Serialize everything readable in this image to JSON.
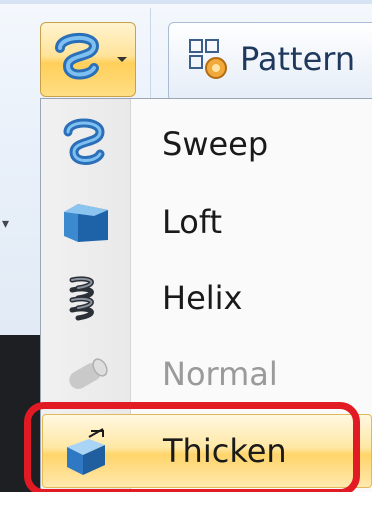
{
  "ribbon": {
    "sweep_button_icon": "sweep-icon",
    "pattern_button": {
      "label": "Pattern",
      "icon": "pattern-icon"
    }
  },
  "menu": {
    "items": [
      {
        "label": "Sweep",
        "icon": "sweep-icon",
        "enabled": true
      },
      {
        "label": "Loft",
        "icon": "loft-icon",
        "enabled": true
      },
      {
        "label": "Helix",
        "icon": "helix-icon",
        "enabled": true
      },
      {
        "label": "Normal",
        "icon": "normal-icon",
        "enabled": false
      },
      {
        "label": "Thicken",
        "icon": "thicken-icon",
        "enabled": true,
        "highlighted": true
      }
    ]
  },
  "colors": {
    "highlight": "#ffd46a",
    "callout": "#e21a24",
    "label_text": "#1a1a1a",
    "disabled_text": "#9a9a9a"
  }
}
